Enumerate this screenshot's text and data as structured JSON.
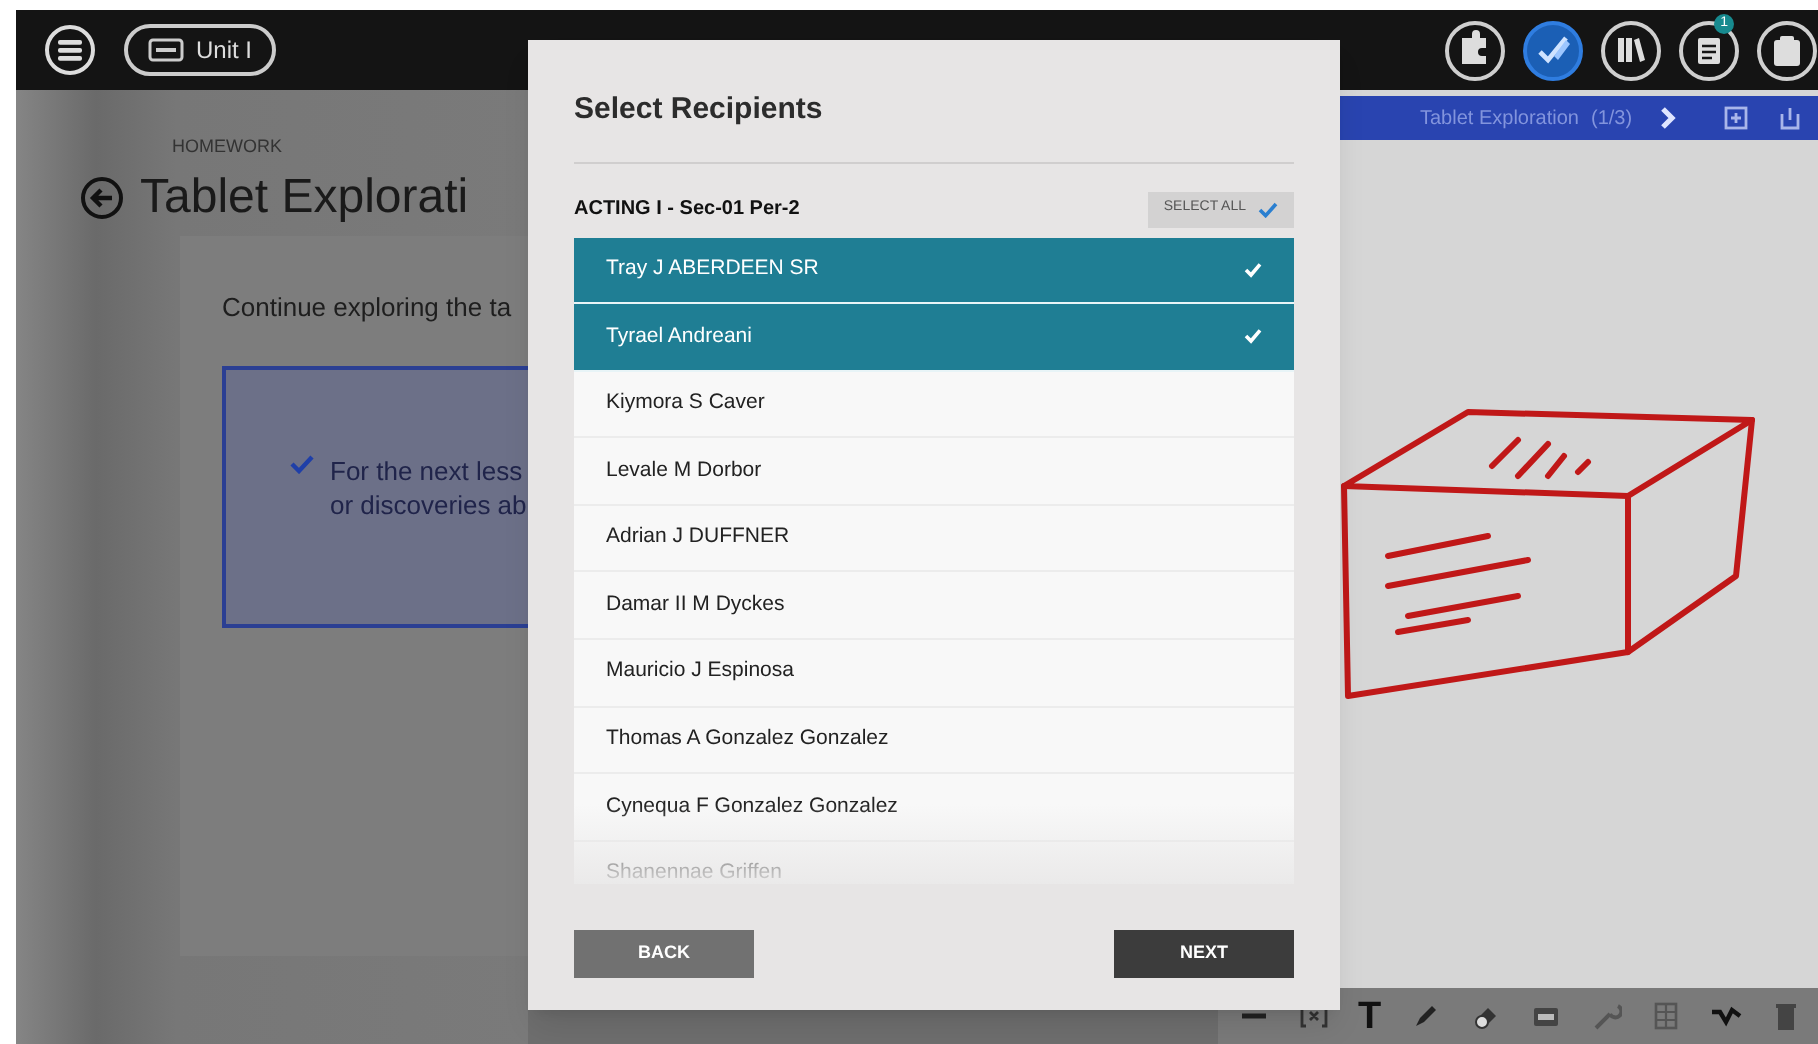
{
  "top_bar": {
    "unit_button": {
      "label": "Unit I"
    },
    "apps": [
      {
        "kind": "puzzle",
        "selected": false
      },
      {
        "kind": "pencil",
        "selected": true
      },
      {
        "kind": "books",
        "selected": false
      },
      {
        "kind": "notes",
        "selected": false,
        "badge": "1"
      },
      {
        "kind": "clipboard",
        "selected": false
      }
    ]
  },
  "lesson": {
    "eyebrow": "HOMEWORK",
    "title": "Tablet Explorati",
    "instructions": "Continue exploring the ta",
    "task": {
      "checked": true,
      "lines": [
        "For the next less",
        "or discoveries ab"
      ]
    }
  },
  "viewer": {
    "title": "Tablet Exploration",
    "page": "(1/3)"
  },
  "toolbar": {
    "tools": [
      {
        "kind": "minus"
      },
      {
        "kind": "bracket"
      },
      {
        "kind": "text",
        "label": "T"
      },
      {
        "kind": "pen"
      },
      {
        "kind": "eraser"
      },
      {
        "kind": "image"
      },
      {
        "kind": "wrench"
      },
      {
        "kind": "grid"
      },
      {
        "kind": "squiggle"
      },
      {
        "kind": "trash"
      }
    ]
  },
  "dialog": {
    "title": "Select Recipients",
    "section": "ACTING I - Sec-01 Per-2",
    "select_all": {
      "label": "SELECT ALL",
      "checked": true
    },
    "recipients": [
      {
        "name": "Tray J ABERDEEN SR",
        "selected": true
      },
      {
        "name": "Tyrael Andreani",
        "selected": true
      },
      {
        "name": "Kiymora S Caver",
        "selected": false
      },
      {
        "name": "Levale M Dorbor",
        "selected": false
      },
      {
        "name": "Adrian J DUFFNER",
        "selected": false
      },
      {
        "name": "Damar II M Dyckes",
        "selected": false
      },
      {
        "name": "Mauricio J Espinosa",
        "selected": false
      },
      {
        "name": "Thomas A Gonzalez Gonzalez",
        "selected": false
      },
      {
        "name": "Cynequa F Gonzalez Gonzalez",
        "selected": false
      },
      {
        "name": "Shanennae Griffen",
        "selected": false
      }
    ],
    "buttons": [
      {
        "label": "BACK",
        "kind": "secondary"
      },
      {
        "label": "NEXT",
        "kind": "primary"
      }
    ]
  }
}
